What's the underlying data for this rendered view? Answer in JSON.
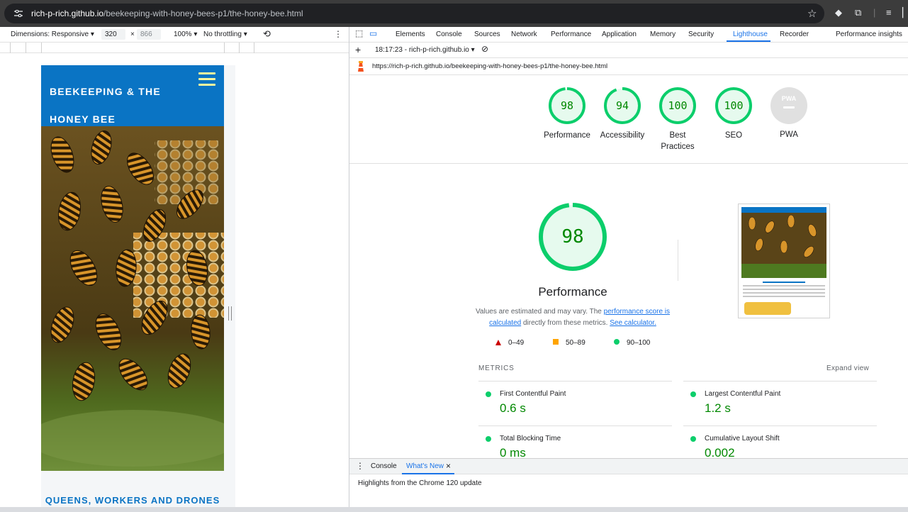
{
  "browser": {
    "url_host": "rich-p-rich.github.io",
    "url_path": "/beekeeping-with-honey-bees-p1/the-honey-bee.html"
  },
  "device_toolbar": {
    "dimensions_label": "Dimensions: Responsive",
    "width": "320",
    "times": "×",
    "height": "866",
    "zoom": "100%",
    "throttling": "No throttling"
  },
  "site": {
    "brand": "BEEKEEPING & THE HONEY BEE",
    "section_title": "QUEENS, WORKERS AND DRONES"
  },
  "devtools": {
    "tabs": [
      "Elements",
      "Console",
      "Sources",
      "Network",
      "Performance",
      "Application",
      "Memory",
      "Security",
      "Lighthouse",
      "Recorder",
      "Performance insights"
    ],
    "active_tab": "Lighthouse",
    "report_selector": "18:17:23 - rich-p-rich.github.io",
    "report_url": "https://rich-p-rich.github.io/beekeeping-with-honey-bees-p1/the-honey-bee.html"
  },
  "lighthouse": {
    "scores": [
      {
        "label": "Performance",
        "score": "98"
      },
      {
        "label": "Accessibility",
        "score": "94"
      },
      {
        "label": "Best Practices",
        "score": "100"
      },
      {
        "label": "SEO",
        "score": "100"
      }
    ],
    "pwa_label": "PWA",
    "pwa_badge": "PWA",
    "big_score": "98",
    "big_title": "Performance",
    "desc_prefix": "Values are estimated and may vary. The ",
    "desc_link1": "performance score is calculated",
    "desc_mid": " directly from these metrics. ",
    "desc_link2": "See calculator.",
    "legend": {
      "fail": "0–49",
      "average": "50–89",
      "pass": "90–100"
    },
    "metrics_label": "METRICS",
    "expand_label": "Expand view",
    "metrics": [
      {
        "name": "First Contentful Paint",
        "value": "0.6 s"
      },
      {
        "name": "Largest Contentful Paint",
        "value": "1.2 s"
      },
      {
        "name": "Total Blocking Time",
        "value": "0 ms"
      },
      {
        "name": "Cumulative Layout Shift",
        "value": "0.002"
      }
    ]
  },
  "drawer": {
    "tabs": [
      "Console",
      "What's New"
    ],
    "active_tab": "What's New",
    "close": "×",
    "body": "Highlights from the Chrome 120 update"
  },
  "colors": {
    "site_header": "#0a74c4",
    "pass_green": "#0cce6b",
    "score_text": "#008800",
    "active_blue": "#1a73e8"
  }
}
